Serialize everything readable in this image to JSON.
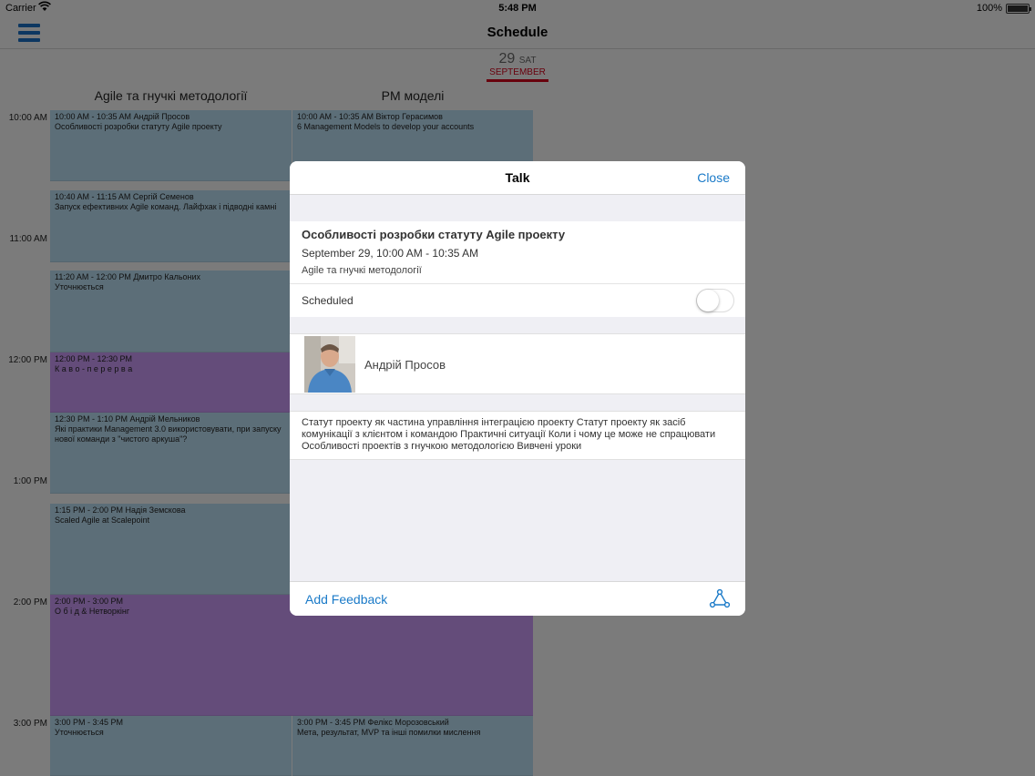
{
  "status_bar": {
    "carrier": "Carrier",
    "time": "5:48 PM",
    "battery": "100%"
  },
  "nav": {
    "title": "Schedule",
    "menu_icon": "hamburger-menu-icon"
  },
  "date_selector": {
    "day": "29",
    "weekday": "SAT",
    "month": "SEPTEMBER"
  },
  "rooms": [
    "Agile та гнучкі методології",
    "PM моделі"
  ],
  "hours": [
    "10:00 AM",
    "11:00 AM",
    "12:00 PM",
    "1:00 PM",
    "2:00 PM",
    "3:00 PM"
  ],
  "sessions": [
    {
      "time": "10:00 AM - 10:35 AM  Андрій Просов",
      "title": "Особливості розробки статуту Agile проекту"
    },
    {
      "time": "10:40 AM - 11:15 AM  Сергій Семенов",
      "title": "Запуск ефективних Agile команд. Лайфхак і підводні камні"
    },
    {
      "time": "11:20 AM - 12:00 PM  Дмитро Кальоних",
      "title": "Уточнюється"
    },
    {
      "time": "12:00 PM - 12:30 PM",
      "title": "К а в о - п е р е р в а"
    },
    {
      "time": "12:30 PM - 1:10 PM  Андрій Мельников",
      "title": "Які практики Management 3.0 використовувати, при запуску нової команди з \"чистого аркуша\"?"
    },
    {
      "time": "1:15 PM - 2:00 PM  Надія Земскова",
      "title": "Scaled Agile at Scalepoint"
    },
    {
      "time": "2:00 PM - 3:00 PM",
      "title": "О б і д & Нетворкінг"
    },
    {
      "time": "3:00 PM - 3:45 PM",
      "title": "Уточнюється"
    },
    {
      "time": "10:00 AM - 10:35 AM  Віктор Герасимов",
      "title": "6 Management Models to develop your accounts"
    },
    {
      "time": "3:00 PM - 3:45 PM  Фелікс Морозовський",
      "title": "Мета, результат, MVP та інші помилки мислення"
    }
  ],
  "modal": {
    "title": "Talk",
    "close": "Close",
    "talk_title": "Особливості розробки статуту Agile проекту",
    "talk_time": "September 29, 10:00 AM - 10:35 AM",
    "talk_room": "Agile та гнучкі методології",
    "scheduled_label": "Scheduled",
    "scheduled": false,
    "speaker_name": "Андрій Просов",
    "description": "Статут проекту як частина управління інтеграцією проекту Статут проекту як засіб комунікації з клієнтом і командою Практичні ситуації Коли і чому це може не спрацювати Особливості проектів з гнучкою методологією Вивчені уроки",
    "add_feedback": "Add Feedback",
    "share_icon": "share-icon"
  },
  "colors": {
    "accent": "#1a7ac8",
    "session_blue": "#b9dcf0",
    "session_purple": "#c899f5",
    "date_red": "#d0021b"
  }
}
